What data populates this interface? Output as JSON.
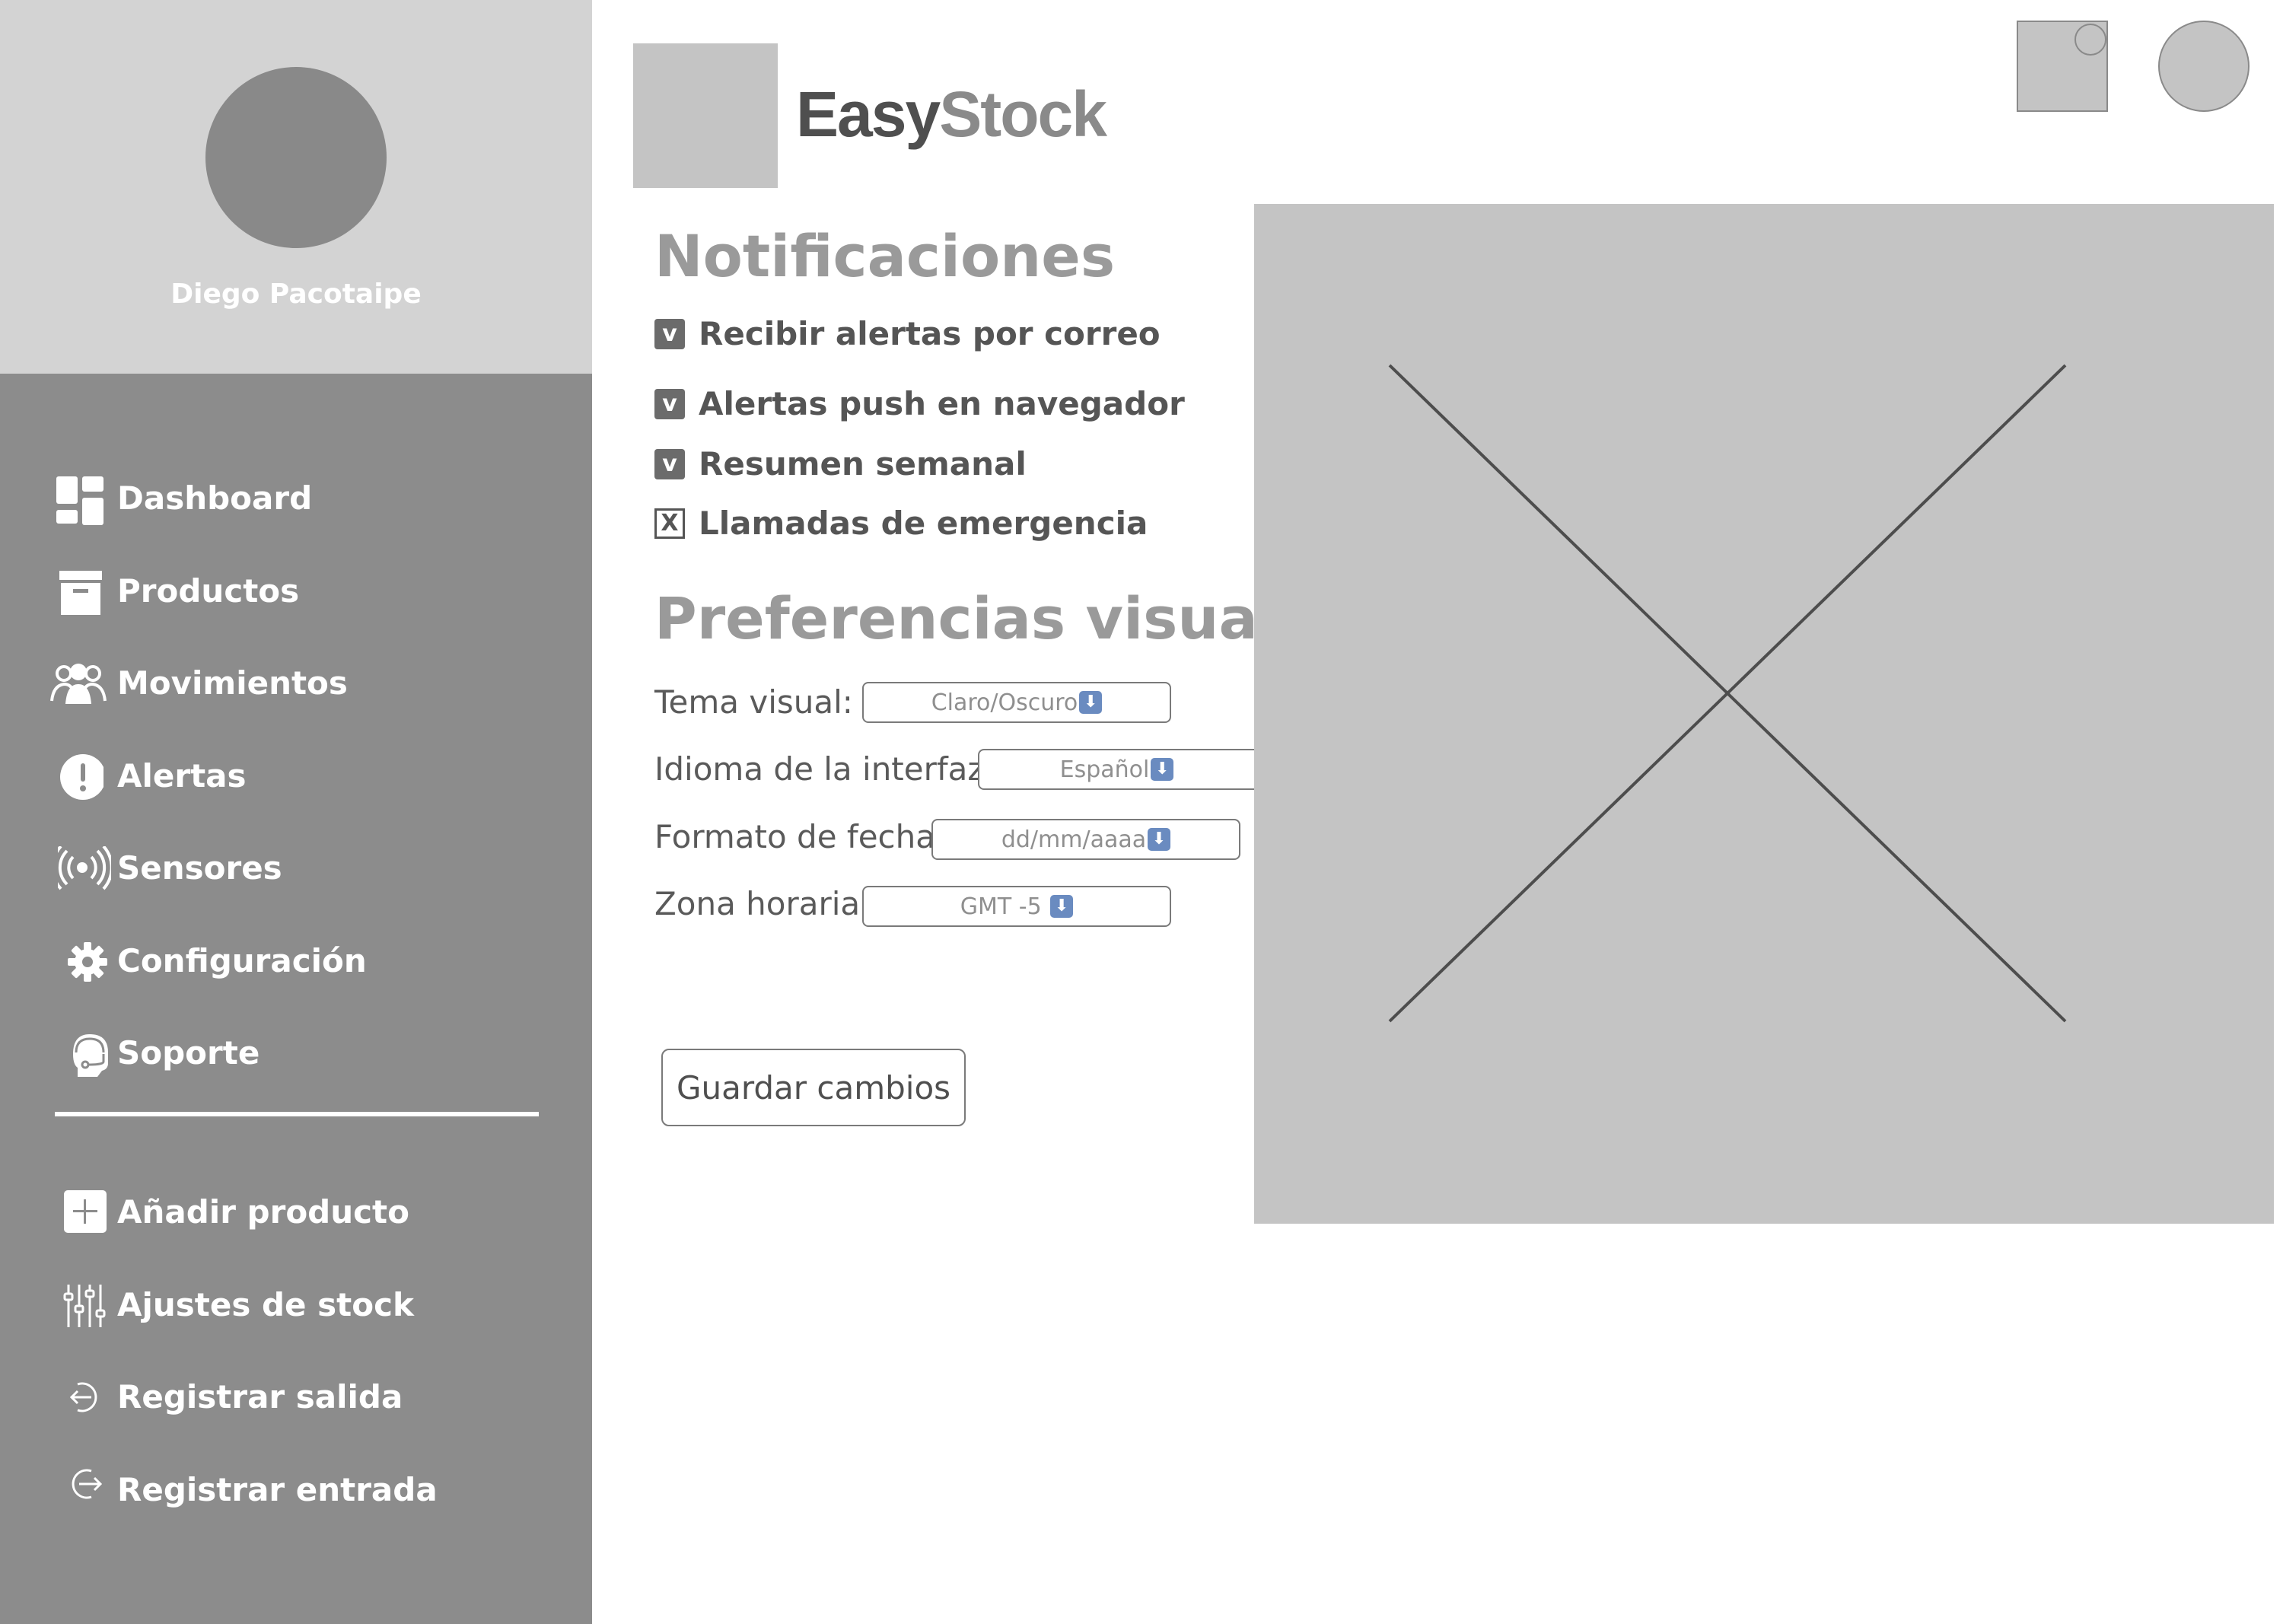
{
  "profile": {
    "name": "Diego Pacotaipe"
  },
  "sidebar": {
    "items": [
      {
        "label": "Dashboard",
        "icon": "dashboard-icon"
      },
      {
        "label": "Productos",
        "icon": "archive-box-icon"
      },
      {
        "label": "Movimientos",
        "icon": "users-icon"
      },
      {
        "label": "Alertas",
        "icon": "exclamation-icon"
      },
      {
        "label": "Sensores",
        "icon": "sensor-icon"
      },
      {
        "label": "Configuración",
        "icon": "gear-icon"
      },
      {
        "label": "Soporte",
        "icon": "support-headset-icon"
      }
    ],
    "actions": [
      {
        "label": "Añadir producto",
        "icon": "plus-square-icon"
      },
      {
        "label": "Ajustes de stock",
        "icon": "sliders-icon"
      },
      {
        "label": "Registrar salida",
        "icon": "logout-icon"
      },
      {
        "label": "Registrar entrada",
        "icon": "login-icon"
      }
    ]
  },
  "header": {
    "brand_part1": "Easy",
    "brand_part2": "Stock"
  },
  "notifications": {
    "title": "Notificaciones",
    "options": [
      {
        "label": "Recibir alertas por correo",
        "mark": "v",
        "checked": true
      },
      {
        "label": "Alertas push en navegador",
        "mark": "v",
        "checked": true
      },
      {
        "label": "Resumen semanal",
        "mark": "v",
        "checked": true
      },
      {
        "label": "Llamadas de emergencia",
        "mark": "X",
        "checked": false
      }
    ]
  },
  "preferences": {
    "title": "Preferencias visuales",
    "theme": {
      "label": "Tema visual:",
      "value": "Claro/Oscuro"
    },
    "language": {
      "label": "Idioma de la interfaz:",
      "value": "Español"
    },
    "date_format": {
      "label": "Formato de fecha:",
      "value": "dd/mm/aaaa"
    },
    "timezone": {
      "label": "Zona horaria:",
      "value": "GMT -5"
    }
  },
  "save_label": "Guardar cambios",
  "colors": {
    "sidebar": "#8c8c8c",
    "profile_bg": "#d3d3d3",
    "placeholder": "#c4c4c4",
    "heading": "#9a9a9a"
  }
}
